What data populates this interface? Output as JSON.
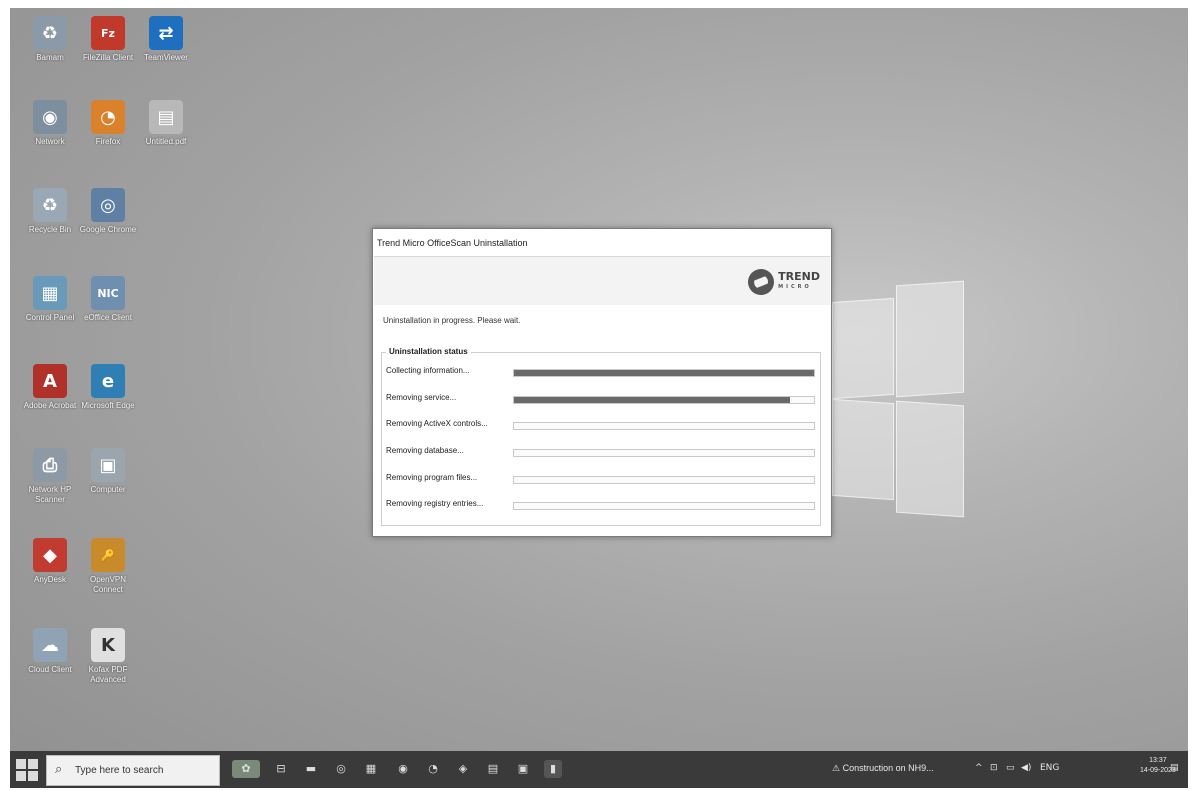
{
  "desktop": {
    "icons": [
      {
        "name": "recycle-bin-icon-top",
        "label": "Bamam",
        "glyph": "♻",
        "color": "#8a9aa8"
      },
      {
        "name": "filezilla-icon",
        "label": "FileZilla Client",
        "glyph": "Fz",
        "color": "#c0392b"
      },
      {
        "name": "teamviewer-icon",
        "label": "TeamViewer",
        "glyph": "⇄",
        "color": "#1e6fbf"
      },
      {
        "name": "network-icon",
        "label": "Network",
        "glyph": "◉",
        "color": "#7d8f9e"
      },
      {
        "name": "firefox-icon",
        "label": "Firefox",
        "glyph": "◔",
        "color": "#d9822b"
      },
      {
        "name": "file-icon",
        "label": "Untitled.pdf",
        "glyph": "▤",
        "color": "#b8b8b8"
      },
      {
        "name": "recycle-bin-icon",
        "label": "Recycle Bin",
        "glyph": "♻",
        "color": "#9aa8b5"
      },
      {
        "name": "chrome-icon",
        "label": "Google Chrome",
        "glyph": "◎",
        "color": "#5f7fa5"
      },
      {
        "name": "control-panel-icon",
        "label": "Control Panel",
        "glyph": "▦",
        "color": "#6a9ab9"
      },
      {
        "name": "nic-icon",
        "label": "eOffice Client",
        "glyph": "NIC",
        "color": "#6f8fb0"
      },
      {
        "name": "acrobat-icon",
        "label": "Adobe Acrobat",
        "glyph": "A",
        "color": "#b0302a"
      },
      {
        "name": "edge-icon",
        "label": "Microsoft Edge",
        "glyph": "e",
        "color": "#2f7fb5"
      },
      {
        "name": "printer-icon",
        "label": "Network HP Scanner",
        "glyph": "⎙",
        "color": "#8d9aa6"
      },
      {
        "name": "computer-icon",
        "label": "Computer",
        "glyph": "▣",
        "color": "#9aa5ad"
      },
      {
        "name": "anydesk-icon",
        "label": "AnyDesk",
        "glyph": "◆",
        "color": "#c23b30"
      },
      {
        "name": "vpn-icon",
        "label": "OpenVPN Connect",
        "glyph": "🔑",
        "color": "#c98a2b"
      },
      {
        "name": "cloud-icon",
        "label": "Cloud Client",
        "glyph": "☁",
        "color": "#8fa3b4"
      },
      {
        "name": "pdf-icon",
        "label": "Kofax PDF Advanced",
        "glyph": "K",
        "color": "#e0e0e0"
      }
    ]
  },
  "dialog": {
    "title": "Trend Micro OfficeScan Uninstallation",
    "brand": "TREND",
    "brand_sub": "MICRO",
    "message": "Uninstallation in progress. Please wait.",
    "status_heading": "Uninstallation status",
    "steps": [
      {
        "label": "Collecting information...",
        "progress": 1.0
      },
      {
        "label": "Removing service...",
        "progress": 0.92
      },
      {
        "label": "Removing ActiveX controls...",
        "progress": 0
      },
      {
        "label": "Removing database...",
        "progress": 0
      },
      {
        "label": "Removing program files...",
        "progress": 0
      },
      {
        "label": "Removing registry entries...",
        "progress": 0
      }
    ]
  },
  "taskbar": {
    "search_placeholder": "Type here to search",
    "notification": "Construction on NH9...",
    "language": "ENG",
    "time": "13:37",
    "date": "14-09-2023"
  }
}
